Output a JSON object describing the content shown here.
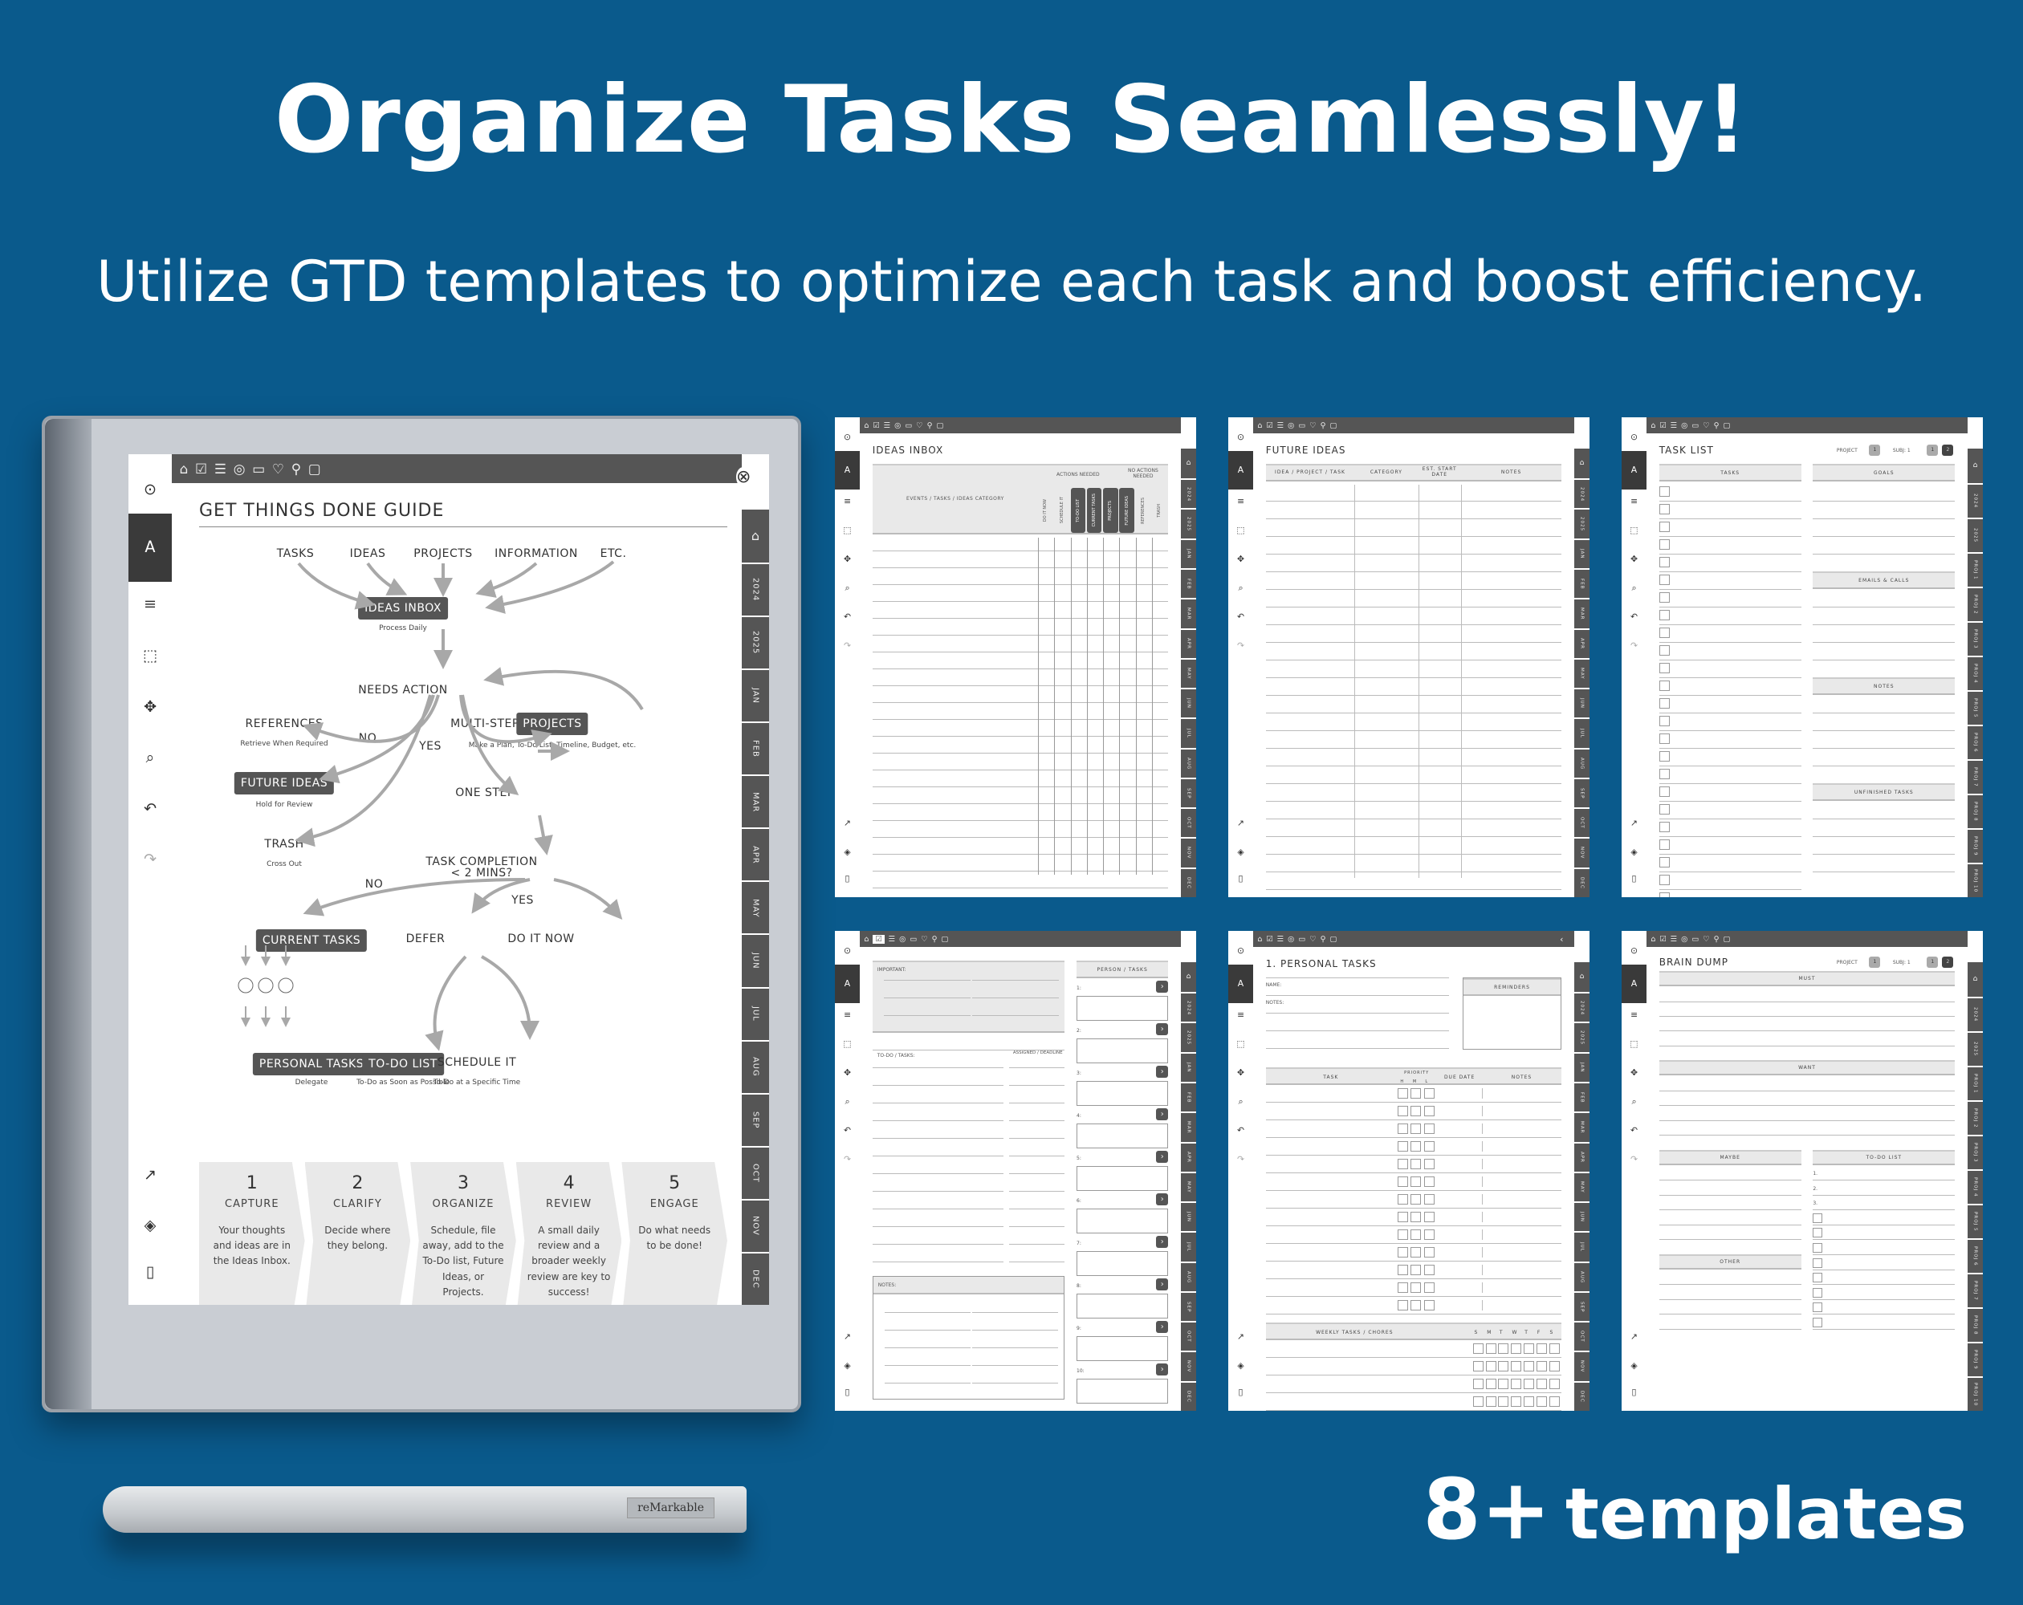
{
  "hero": {
    "title": "Organize Tasks Seamlessly!",
    "subtitle": "Utilize GTD templates to optimize each task and boost efficiency."
  },
  "badge": {
    "number": "8+",
    "label": "templates"
  },
  "pen": {
    "brand": "reMarkable"
  },
  "colors": {
    "background": "#0a5a8c",
    "dark": "#555555",
    "header_fill": "#e9e9e9",
    "text": "#ffffff"
  },
  "device_toolbar_icons": [
    "menu-circle-icon",
    "pen-icon",
    "strokes-icon",
    "eraser-select-icon",
    "move-icon",
    "zoom-icon",
    "undo-icon",
    "redo-icon",
    "share-icon",
    "layers-icon",
    "notebook-icon"
  ],
  "top_nav_icons": [
    "home-icon",
    "checkbox-icon",
    "clipboard-icon",
    "target-icon",
    "wallet-icon",
    "heart-icon",
    "bike-icon",
    "page-icon"
  ],
  "month_tabs": [
    "2024",
    "2025",
    "JAN",
    "FEB",
    "MAR",
    "APR",
    "MAY",
    "JUN",
    "JUL",
    "AUG",
    "SEP",
    "OCT",
    "NOV",
    "DEC"
  ],
  "project_tabs": [
    "2024",
    "2025",
    "PROJ 1",
    "PROJ 2",
    "PROJ 3",
    "PROJ 4",
    "PROJ 5",
    "PROJ 6",
    "PROJ 7",
    "PROJ 8",
    "PROJ 9",
    "PROJ 10"
  ],
  "guide": {
    "title": "GET THINGS DONE GUIDE",
    "inputs": [
      "TASKS",
      "IDEAS",
      "PROJECTS",
      "INFORMATION",
      "ETC."
    ],
    "ideas_inbox": "IDEAS INBOX",
    "ideas_inbox_sub": "Process Daily",
    "needs_action": "NEEDS ACTION",
    "no": "NO",
    "yes": "YES",
    "references": "REFERENCES",
    "references_sub": "Retrieve When Required",
    "future_ideas": "FUTURE IDEAS",
    "future_ideas_sub": "Hold for Review",
    "trash": "TRASH",
    "trash_sub": "Cross Out",
    "multi_step": "MULTI-STEP",
    "projects": "PROJECTS",
    "projects_sub": "Make a Plan, To-Do List, Timeline, Budget, etc.",
    "one_step": "ONE STEP",
    "task_completion": "TASK COMPLETION",
    "task_completion_2": "< 2 MINS?",
    "current_tasks": "CURRENT TASKS",
    "defer": "DEFER",
    "do_it_now": "DO IT NOW",
    "personal_tasks": "PERSONAL TASKS",
    "personal_tasks_sub": "Delegate",
    "todo_list": "TO-DO LIST",
    "todo_list_sub": "To-Do as Soon as Possible",
    "schedule_it": "SCHEDULE IT",
    "schedule_it_sub": "To-Do at a Specific Time",
    "steps": [
      {
        "num": "1",
        "title": "CAPTURE",
        "desc": "Your thoughts and ideas are in the Ideas Inbox."
      },
      {
        "num": "2",
        "title": "CLARIFY",
        "desc": "Decide where they belong."
      },
      {
        "num": "3",
        "title": "ORGANIZE",
        "desc": "Schedule, file away, add to the To-Do list, Future Ideas, or Projects."
      },
      {
        "num": "4",
        "title": "REVIEW",
        "desc": "A small daily review and a broader weekly review are key to success!"
      },
      {
        "num": "5",
        "title": "ENGAGE",
        "desc": "Do what needs to be done!"
      }
    ]
  },
  "templates": {
    "ideas_inbox": {
      "title": "IDEAS INBOX",
      "col_main": "EVENTS / TASKS / IDEAS CATEGORY",
      "group_actions": "ACTIONS NEEDED",
      "group_no_actions": "NO ACTIONS NEEDED",
      "cols": [
        "DO IT NOW",
        "SCHEDULE IT",
        "TO-DO LIST",
        "CURRENT TASKS",
        "PROJECTS",
        "FUTURE IDEAS",
        "REFERENCES",
        "TRASH"
      ]
    },
    "future_ideas": {
      "title": "FUTURE IDEAS",
      "cols": [
        "IDEA / PROJECT / TASK",
        "CATEGORY",
        "EST. START DATE",
        "NOTES"
      ]
    },
    "task_list": {
      "title": "TASK LIST",
      "project_label": "PROJECT",
      "project_val": "1",
      "subj_label": "SUBJ: 1",
      "pages": [
        "1",
        "2"
      ],
      "tasks": "TASKS",
      "goals": "GOALS",
      "emails": "EMAILS & CALLS",
      "notes": "NOTES",
      "unfinished": "UNFINISHED TASKS"
    },
    "delegation": {
      "important": "IMPORTANT:",
      "todo": "TO-DO / TASKS:",
      "assigned": "ASSIGNED / DEADLINE",
      "notes": "NOTES:",
      "person_tasks": "PERSON / TASKS",
      "persons": [
        "1:",
        "2:",
        "3:",
        "4:",
        "5:",
        "6:",
        "7:",
        "8:",
        "9:",
        "10:"
      ]
    },
    "personal_tasks": {
      "title": "1. PERSONAL TASKS",
      "name": "NAME:",
      "notes": "NOTES:",
      "reminders": "REMINDERS",
      "cols": [
        "TASK",
        "PRIORITY",
        "DUE DATE",
        "NOTES"
      ],
      "priority_levels": [
        "H",
        "M",
        "L"
      ],
      "weekly": "WEEKLY TASKS / CHORES",
      "days": [
        "S",
        "M",
        "T",
        "W",
        "T",
        "F",
        "S"
      ]
    },
    "brain_dump": {
      "title": "BRAIN DUMP",
      "project_label": "PROJECT",
      "project_val": "1",
      "subj_label": "SUBJ: 1",
      "pages": [
        "1",
        "2"
      ],
      "must": "MUST",
      "want": "WANT",
      "maybe": "MAYBE",
      "todo": "TO-DO LIST",
      "other": "OTHER",
      "numbered": [
        "1.",
        "2.",
        "3."
      ]
    }
  }
}
